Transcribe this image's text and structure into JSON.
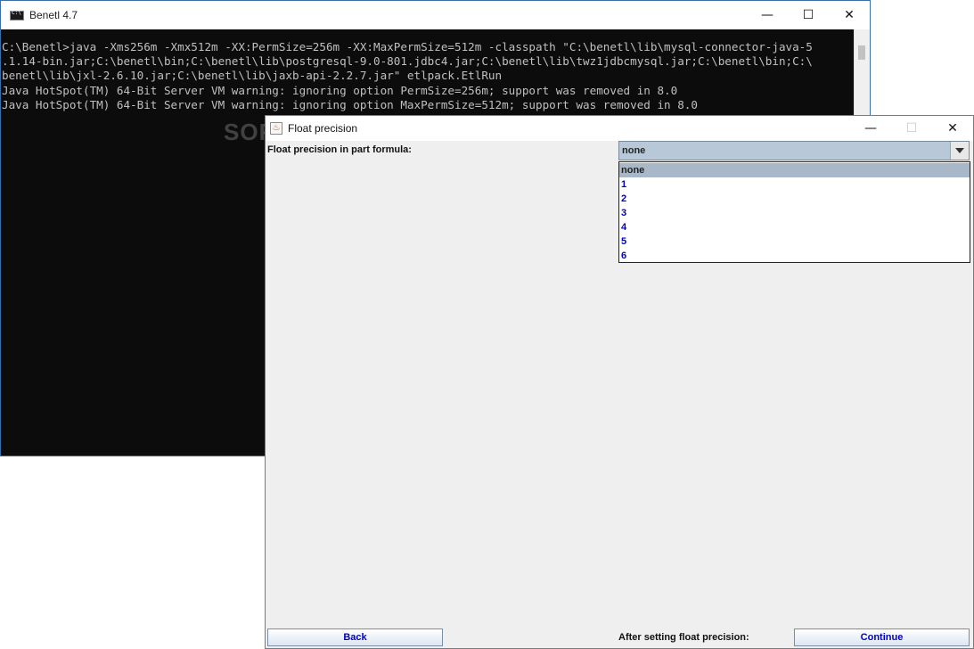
{
  "console": {
    "title": "Benetl 4.7",
    "lines": [
      "C:\\Benetl>java -Xms256m -Xmx512m -XX:PermSize=256m -XX:MaxPermSize=512m -classpath \"C:\\benetl\\lib\\mysql-connector-java-5",
      ".1.14-bin.jar;C:\\benetl\\bin;C:\\benetl\\lib\\postgresql-9.0-801.jdbc4.jar;C:\\benetl\\lib\\twz1jdbcmysql.jar;C:\\benetl\\bin;C:\\",
      "benetl\\lib\\jxl-2.6.10.jar;C:\\benetl\\lib\\jaxb-api-2.2.7.jar\" etlpack.EtlRun",
      "Java HotSpot(TM) 64-Bit Server VM warning: ignoring option PermSize=256m; support was removed in 8.0",
      "Java HotSpot(TM) 64-Bit Server VM warning: ignoring option MaxPermSize=512m; support was removed in 8.0"
    ],
    "watermark": "SOFTPEDIA"
  },
  "window_controls": {
    "minimize": "—",
    "maximize": "☐",
    "close": "✕"
  },
  "dialog": {
    "title": "Float precision",
    "precision_label": "Float precision in part formula:",
    "selected_value": "none",
    "options": [
      "none",
      "1",
      "2",
      "3",
      "4",
      "5",
      "6"
    ],
    "back_label": "Back",
    "after_label": "After setting float precision:",
    "continue_label": "Continue"
  }
}
